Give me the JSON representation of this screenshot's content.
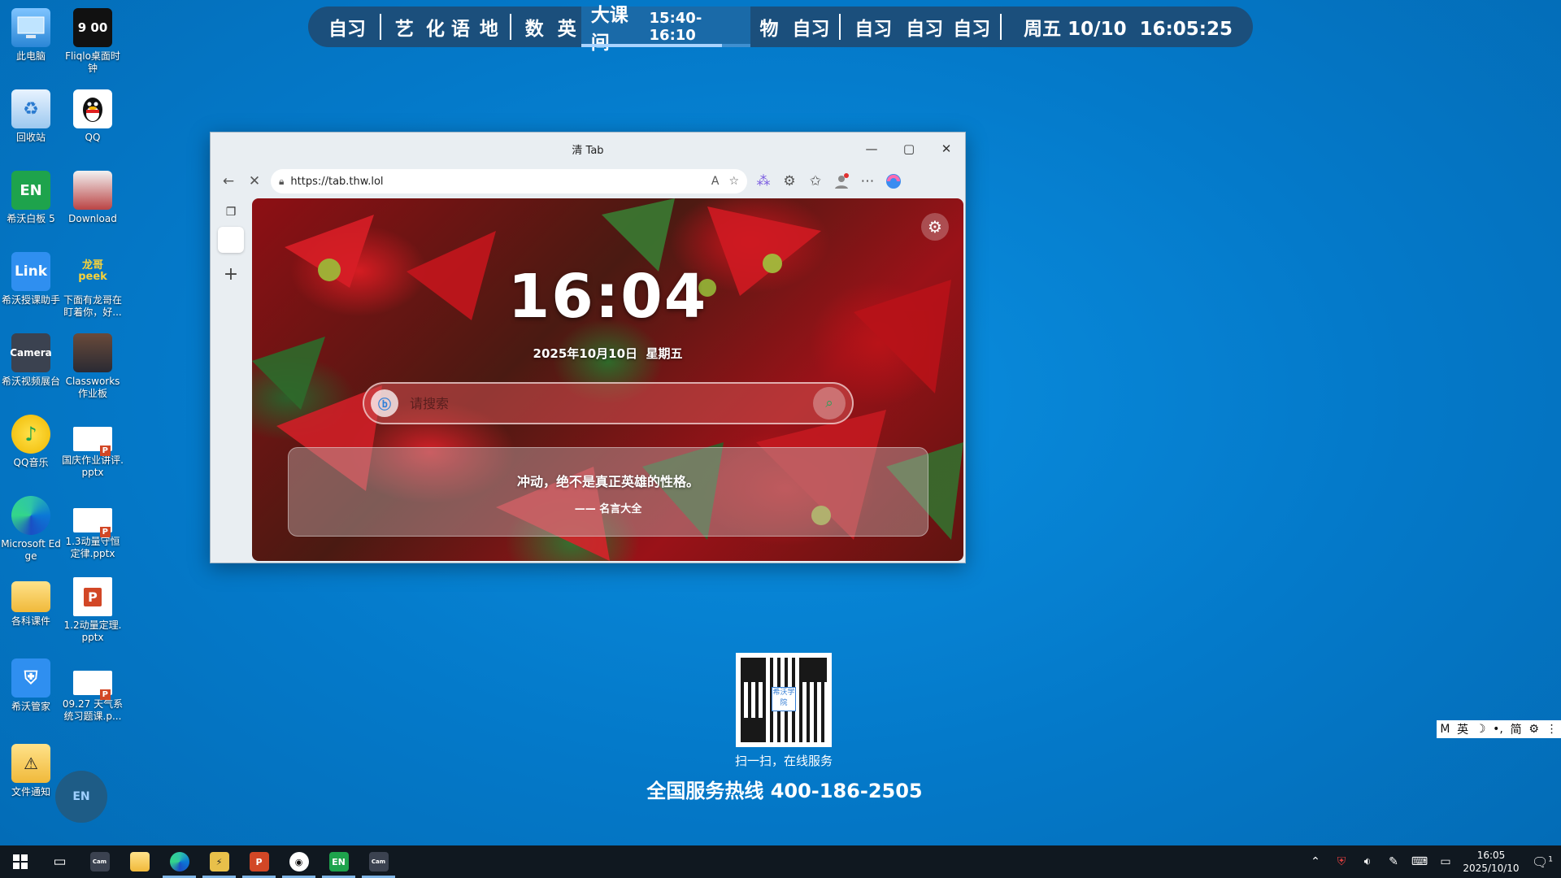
{
  "desktop_icons": [
    {
      "label": "此电脑",
      "icon": "computer-icon"
    },
    {
      "label": "Fliqlo桌面时钟",
      "icon": "clock-app-icon",
      "glyph": "9 00"
    },
    {
      "label": "回收站",
      "icon": "recycle-bin-icon"
    },
    {
      "label": "QQ",
      "icon": "qq-icon"
    },
    {
      "label": "希沃白板 5",
      "icon": "seewo-whiteboard-icon",
      "glyph": "EN"
    },
    {
      "label": "Download",
      "icon": "download-folder-icon"
    },
    {
      "label": "希沃授课助手",
      "icon": "seewo-link-icon",
      "glyph": "Link"
    },
    {
      "label": "下面有龙哥在盯着你，好...",
      "icon": "image-file-icon",
      "glyph": "龙哥 peek"
    },
    {
      "label": "希沃视频展台",
      "icon": "seewo-camera-icon",
      "glyph": "Camera"
    },
    {
      "label": "Classworks作业板",
      "icon": "classworks-icon"
    },
    {
      "label": "QQ音乐",
      "icon": "qq-music-icon"
    },
    {
      "label": "国庆作业讲评.pptx",
      "icon": "pptx-file-icon"
    },
    {
      "label": "Microsoft Edge",
      "icon": "edge-icon"
    },
    {
      "label": "1.3动量守恒定律.pptx",
      "icon": "pptx-file-icon"
    },
    {
      "label": "各科课件",
      "icon": "folder-icon"
    },
    {
      "label": "1.2动量定理.pptx",
      "icon": "powerpoint-icon"
    },
    {
      "label": "希沃管家",
      "icon": "seewo-guard-icon"
    },
    {
      "label": "09.27 天气系统习题课.p...",
      "icon": "pptx-file-icon"
    },
    {
      "label": "文件通知",
      "icon": "folder-warning-icon"
    }
  ],
  "schedule": {
    "items": [
      "自习",
      "艺",
      "化",
      "语",
      "地",
      "数",
      "英",
      "物",
      "自习",
      "自习",
      "自习",
      "自习"
    ],
    "current_label": "大课间",
    "current_range": "15:40-16:10",
    "current_progress": 0.83,
    "clock": "周五 10/10  16:05:25"
  },
  "browser": {
    "title": "清 Tab",
    "url": "https://tab.thw.lol",
    "clock": "16:04",
    "date": "2025年10月10日  星期五",
    "search_placeholder": "请搜索",
    "quote": "冲动，绝不是真正英雄的性格。",
    "quote_source": "—— 名言大全",
    "colors": {
      "accent": "#c7141c",
      "leaf": "#2f6a2a"
    }
  },
  "qr": {
    "center_text": "希沃学院",
    "caption": "扫一扫，在线服务",
    "hotline": "全国服务热线 400-186-2505"
  },
  "ball_label": "EN",
  "ime": [
    "M",
    "英",
    "☽",
    "•,",
    "简",
    "⚙",
    "⋮"
  ],
  "taskbar": {
    "apps": [
      "start-icon",
      "task-view-icon",
      "seewo-camera-icon",
      "file-explorer-icon",
      "edge-icon",
      "fliqlo-icon",
      "powerpoint-icon",
      "qq-icon",
      "seewo-whiteboard-icon",
      "seewo-camera-icon"
    ],
    "time": "16:05",
    "date": "2025/10/10",
    "notification_count": "1"
  }
}
